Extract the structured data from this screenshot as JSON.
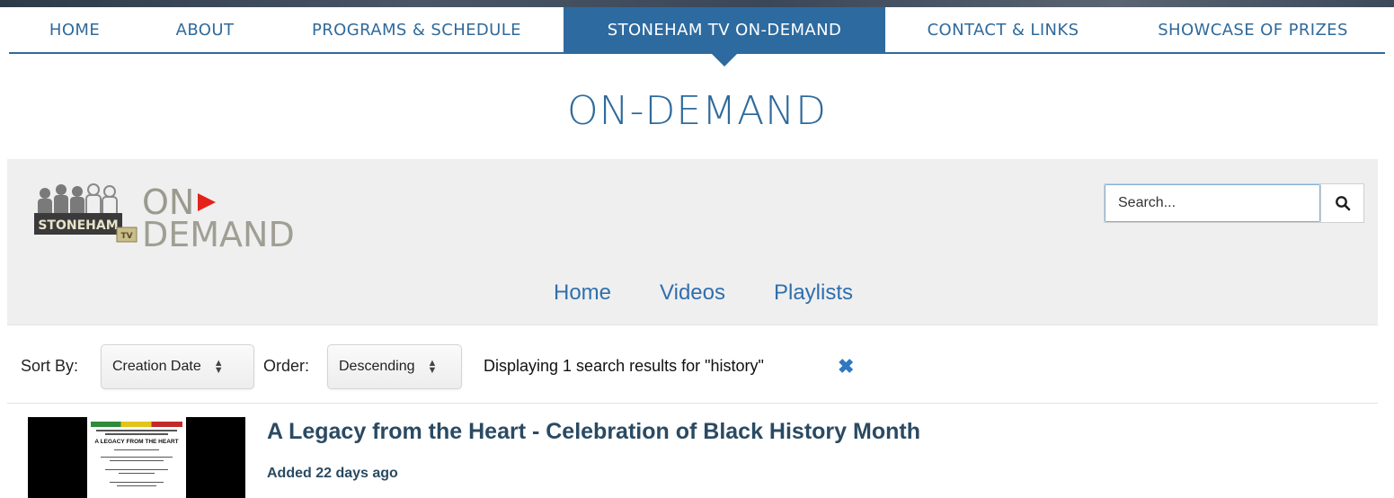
{
  "nav": {
    "items": [
      {
        "label": "HOME",
        "active": false
      },
      {
        "label": "ABOUT",
        "active": false
      },
      {
        "label": "PROGRAMS & SCHEDULE",
        "active": false
      },
      {
        "label": "STONEHAM TV ON-DEMAND",
        "active": true
      },
      {
        "label": "CONTACT & LINKS",
        "active": false
      },
      {
        "label": "SHOWCASE OF PRIZES",
        "active": false
      }
    ]
  },
  "page": {
    "title": "ON-DEMAND"
  },
  "logo": {
    "on": "ON",
    "demand": "DEMAND",
    "stoneham": "STONEHAM",
    "tv": "TV",
    "play_color": "#e3231a"
  },
  "search": {
    "placeholder": "Search...",
    "icon": "search-icon"
  },
  "subnav": {
    "items": [
      "Home",
      "Videos",
      "Playlists"
    ]
  },
  "sort": {
    "sort_by_label": "Sort By:",
    "sort_by_value": "Creation Date",
    "order_label": "Order:",
    "order_value": "Descending",
    "results_text": "Displaying 1 search results for \"history\"",
    "clear_icon": "close-icon"
  },
  "result": {
    "title": "A Legacy from the Heart - Celebration of Black History Month",
    "meta": "Added 22 days ago",
    "thumb_heading": "A LEGACY FROM THE HEART"
  },
  "colors": {
    "accent": "#2d6a9f",
    "link": "#2f6fad",
    "panel": "#efefef",
    "title": "#2a4a62"
  }
}
